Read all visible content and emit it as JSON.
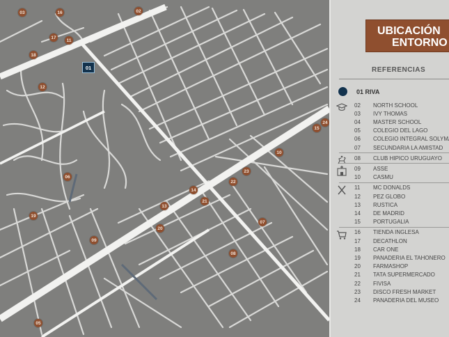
{
  "map": {
    "project_marker": "01",
    "markers": [
      {
        "id": "03"
      },
      {
        "id": "16"
      },
      {
        "id": "02"
      },
      {
        "id": "17"
      },
      {
        "id": "11"
      },
      {
        "id": "18"
      },
      {
        "id": "12"
      },
      {
        "id": "15"
      },
      {
        "id": "24"
      },
      {
        "id": "10"
      },
      {
        "id": "23"
      },
      {
        "id": "22"
      },
      {
        "id": "14"
      },
      {
        "id": "21"
      },
      {
        "id": "13"
      },
      {
        "id": "06"
      },
      {
        "id": "19"
      },
      {
        "id": "20"
      },
      {
        "id": "07"
      },
      {
        "id": "09"
      },
      {
        "id": "08"
      },
      {
        "id": "05"
      }
    ]
  },
  "panel": {
    "title_line1": "UBICACIÓN",
    "title_line2": "ENTORNO",
    "references_label": "REFERENCIAS",
    "project": {
      "number": "01",
      "label": "01 RIVA",
      "color": "#12324d"
    },
    "accent_color": "#8f4f2f",
    "categories": [
      {
        "icon": "graduation-cap-icon",
        "items": [
          {
            "num": "02",
            "label": "NORTH SCHOOL"
          },
          {
            "num": "03",
            "label": "IVY THOMAS"
          },
          {
            "num": "04",
            "label": "MASTER SCHOOL"
          },
          {
            "num": "05",
            "label": "COLEGIO DEL LAGO"
          },
          {
            "num": "06",
            "label": "COLEGIO INTEGRAL SOLYMAR"
          },
          {
            "num": "07",
            "label": "SECUNDARIA LA AMISTAD"
          }
        ]
      },
      {
        "icon": "horse-rider-icon",
        "items": [
          {
            "num": "08",
            "label": "CLUB HIPICO URUGUAYO"
          }
        ]
      },
      {
        "icon": "hospital-icon",
        "items": [
          {
            "num": "09",
            "label": "ASSE"
          },
          {
            "num": "10",
            "label": "CASMU"
          }
        ]
      },
      {
        "icon": "fork-knife-icon",
        "items": [
          {
            "num": "11",
            "label": "MC DONALDS"
          },
          {
            "num": "12",
            "label": "PEZ GLOBO"
          },
          {
            "num": "13",
            "label": "RUSTICA"
          },
          {
            "num": "14",
            "label": "DE MADRID"
          },
          {
            "num": "15",
            "label": "PORTUGALIA"
          }
        ]
      },
      {
        "icon": "shopping-cart-icon",
        "items": [
          {
            "num": "16",
            "label": "TIENDA INGLESA"
          },
          {
            "num": "17",
            "label": "DECATHLON"
          },
          {
            "num": "18",
            "label": "CAR ONE"
          },
          {
            "num": "19",
            "label": "PANADERIA EL TAHONERO"
          },
          {
            "num": "20",
            "label": "FARMASHOP"
          },
          {
            "num": "21",
            "label": "TATA SUPERMERCADO"
          },
          {
            "num": "22",
            "label": "FIVISA"
          },
          {
            "num": "23",
            "label": "DISCO FRESH MARKET"
          },
          {
            "num": "24",
            "label": "PANADERIA DEL MUSEO"
          }
        ]
      }
    ]
  }
}
